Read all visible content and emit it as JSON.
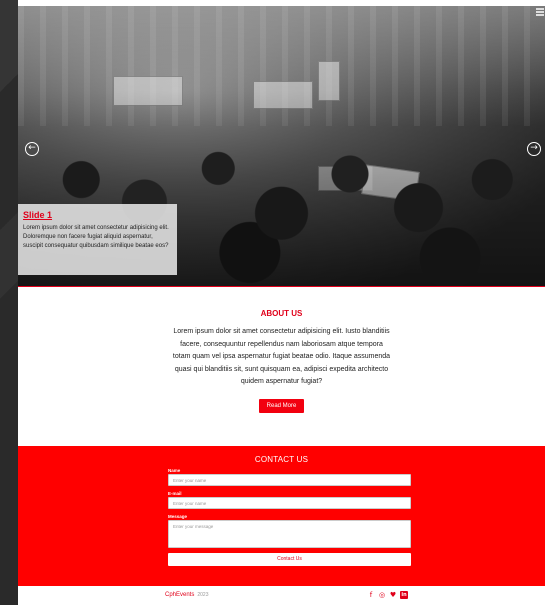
{
  "hero": {
    "slide_title": "Slide 1",
    "slide_text": "Lorem ipsum dolor sit amet consectetur adipisicing elit. Doloremque non facere fugiat aliquid aspernatur, suscipit consequatur quibusdam similique beatae eos?",
    "prev_icon": "arrow-left-circle-icon",
    "next_icon": "arrow-right-circle-icon",
    "prev_glyph": "←",
    "next_glyph": "→",
    "menu_icon": "hamburger-menu-icon"
  },
  "about": {
    "title": "ABOUT US",
    "text": "Lorem ipsum dolor sit amet consectetur adipisicing elit. Iusto blanditiis facere, consequuntur repellendus nam laboriosam atque tempora totam quam vel ipsa aspernatur fugiat beatae odio. Itaque assumenda quasi qui blanditiis sit, sunt quisquam ea, adipisci expedita architecto quidem aspernatur fugiat?",
    "button_label": "Read More"
  },
  "contact": {
    "title": "CONTACT US",
    "name_label": "Name",
    "name_placeholder": "Enter your name",
    "email_label": "E-mail",
    "email_placeholder": "Enter your name",
    "message_label": "Message",
    "message_placeholder": "Enter your message",
    "submit_label": "Contact Us"
  },
  "footer": {
    "brand": "CphEvents",
    "year": "2023",
    "social_icons": [
      "facebook-icon",
      "instagram-icon",
      "twitter-icon",
      "linkedin-icon"
    ],
    "facebook_glyph": "f",
    "instagram_glyph": "◎",
    "twitter_glyph": "♥",
    "linkedin_glyph": "in"
  },
  "colors": {
    "accent": "#e0001a",
    "contact_bg": "#ff0000",
    "backdrop": "#2a2a2a"
  }
}
